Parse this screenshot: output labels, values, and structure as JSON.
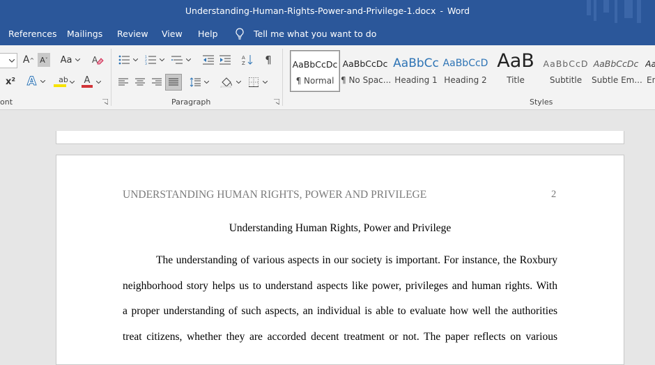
{
  "window": {
    "doc_name": "Understanding-Human-Rights-Power-and-Privilege-1.docx",
    "separator": "-",
    "app_name": "Word"
  },
  "menu": {
    "tabs": [
      "References",
      "Mailings",
      "Review",
      "View",
      "Help"
    ],
    "tell_me": "Tell me what you want to do",
    "tell_icon": "lightbulb-icon"
  },
  "ribbon": {
    "font_group_label": "ont",
    "paragraph_group_label": "Paragraph",
    "styles_group_label": "Styles",
    "font_buttons": {
      "grow_font": "A",
      "shrink_font": "A",
      "change_case": "Aa",
      "superscript": "x²",
      "text_effects": "A",
      "highlight": "ab",
      "font_color": "A"
    },
    "styles": [
      {
        "sample": "AaBbCcDc",
        "name": "¶ Normal"
      },
      {
        "sample": "AaBbCcDc",
        "name": "¶ No Spac..."
      },
      {
        "sample": "AaBbCc",
        "name": "Heading 1"
      },
      {
        "sample": "AaBbCcD",
        "name": "Heading 2"
      },
      {
        "sample": "AaB",
        "name": "Title"
      },
      {
        "sample": "AaBbCcD",
        "name": "Subtitle"
      },
      {
        "sample": "AaBbCcDc",
        "name": "Subtle Em..."
      },
      {
        "sample": "Aa",
        "name": "En"
      }
    ],
    "colors": {
      "highlight": "#f7e300",
      "font_color": "#d13438",
      "accent_blue": "#2e74b5"
    }
  },
  "document": {
    "header_text": "UNDERSTANDING HUMAN RIGHTS, POWER AND PRIVILEGE",
    "page_number": "2",
    "title": "Understanding Human Rights, Power and Privilege",
    "lines": [
      "The understanding of various aspects in our society is important. For instance, the Roxbury",
      "neighborhood story helps us to understand aspects like power, privileges and human rights. With",
      "a proper understanding of such aspects, an individual is able to evaluate how well the authorities",
      "treat citizens, whether they are accorded decent treatment or not. The paper reflects on various"
    ]
  }
}
